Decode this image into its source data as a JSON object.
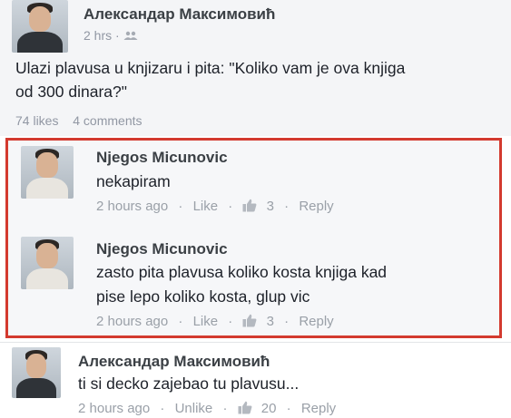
{
  "post": {
    "author": "Александар Максимовић",
    "time": "2 hrs",
    "text_line1": "Ulazi plavusa u knjizaru i pita: \"Koliko vam je ova knjiga",
    "text_line2": "od 300 dinara?\"",
    "likes": "74 likes",
    "comments": "4 comments"
  },
  "comments": [
    {
      "author": "Njegos Micunovic",
      "text_line1": "nekapiram",
      "time": "2 hours ago",
      "like": "Like",
      "like_count": "3",
      "reply": "Reply"
    },
    {
      "author": "Njegos Micunovic",
      "text_line1": "zasto pita plavusa koliko kosta knjiga kad",
      "text_line2": "pise lepo koliko kosta, glup vic",
      "time": "2 hours ago",
      "like": "Like",
      "like_count": "3",
      "reply": "Reply"
    },
    {
      "author": "Александар Максимовић",
      "text_line1": "ti si decko zajebao tu plavusu...",
      "time": "2 hours ago",
      "like": "Unlike",
      "like_count": "20",
      "reply": "Reply"
    }
  ],
  "separator": "·",
  "colors": {
    "highlight": "#d33a2f",
    "meta": "#9197a3"
  }
}
